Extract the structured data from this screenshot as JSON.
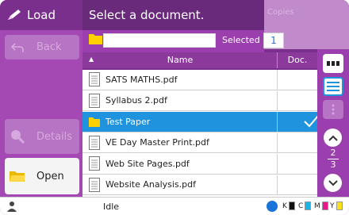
{
  "sidebar": {
    "title": "Load",
    "buttons": {
      "back": "Back",
      "details": "Details",
      "open": "Open"
    }
  },
  "header": {
    "title": "Select a document.",
    "copies_label": "Copies"
  },
  "toolbar": {
    "path_value": "",
    "selected_label": "Selected",
    "selected_count": "1"
  },
  "table": {
    "columns": [
      "Name",
      "Doc."
    ],
    "rows": [
      {
        "name": "SATS MATHS.pdf",
        "type": "file",
        "selected": false
      },
      {
        "name": "Syllabus 2.pdf",
        "type": "file",
        "selected": false
      },
      {
        "name": "Test Paper",
        "type": "folder",
        "selected": true
      },
      {
        "name": "VE Day Master Print.pdf",
        "type": "file",
        "selected": false
      },
      {
        "name": "Web Site Pages.pdf",
        "type": "file",
        "selected": false
      },
      {
        "name": "Website Analysis.pdf",
        "type": "file",
        "selected": false
      }
    ]
  },
  "pager": {
    "current": "2",
    "total": "3"
  },
  "status": {
    "state": "Idle",
    "inks": [
      {
        "label": "K",
        "color": "#111111"
      },
      {
        "label": "C",
        "color": "#19b5e8"
      },
      {
        "label": "M",
        "color": "#e8198f"
      },
      {
        "label": "Y",
        "color": "#f5e21b"
      }
    ]
  },
  "colors": {
    "accent": "#1f93de",
    "brand_purple": "#7b2f8c"
  }
}
